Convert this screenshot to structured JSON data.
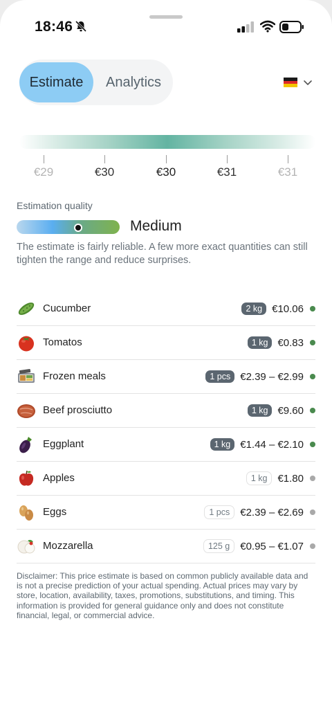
{
  "status_bar": {
    "time": "18:46"
  },
  "tabs": [
    {
      "label": "Estimate",
      "active": true
    },
    {
      "label": "Analytics",
      "active": false
    }
  ],
  "country_flag": "germany-flag-icon",
  "range": {
    "ticks": [
      "€29",
      "€30",
      "€30",
      "€31",
      "€31"
    ],
    "tick_colors": [
      "#b4b4b4",
      "#333333",
      "#222222",
      "#333333",
      "#b4b4b4"
    ]
  },
  "quality": {
    "label": "Estimation quality",
    "value": "Medium",
    "level": 0.6,
    "description": "The estimate is fairly reliable. A few more exact quantities can still tighten the range and reduce surprises."
  },
  "items": [
    {
      "name": "Cucumber",
      "quantity": "2 kg",
      "price": "€10.06",
      "badge_style": "dark",
      "status_color": "#4a8a4e",
      "icon": "cucumber-icon"
    },
    {
      "name": "Tomatos",
      "quantity": "1 kg",
      "price": "€0.83",
      "badge_style": "dark",
      "status_color": "#4a8a4e",
      "icon": "tomato-icon"
    },
    {
      "name": "Frozen meals",
      "quantity": "1 pcs",
      "price": "€2.39 – €2.99",
      "badge_style": "dark",
      "status_color": "#4a8a4e",
      "icon": "frozen-meal-icon"
    },
    {
      "name": "Beef prosciutto",
      "quantity": "1 kg",
      "price": "€9.60",
      "badge_style": "dark",
      "status_color": "#4a8a4e",
      "icon": "prosciutto-icon"
    },
    {
      "name": "Eggplant",
      "quantity": "1 kg",
      "price": "€1.44 – €2.10",
      "badge_style": "dark",
      "status_color": "#4a8a4e",
      "icon": "eggplant-icon"
    },
    {
      "name": "Apples",
      "quantity": "1 kg",
      "price": "€1.80",
      "badge_style": "light",
      "status_color": "#a9a9a9",
      "icon": "apple-icon"
    },
    {
      "name": "Eggs",
      "quantity": "1 pcs",
      "price": "€2.39 – €2.69",
      "badge_style": "light",
      "status_color": "#a9a9a9",
      "icon": "eggs-icon"
    },
    {
      "name": "Mozzarella",
      "quantity": "125 g",
      "price": "€0.95 – €1.07",
      "badge_style": "light",
      "status_color": "#a9a9a9",
      "icon": "mozzarella-icon"
    }
  ],
  "disclaimer": "Disclaimer: This price estimate is based on common publicly available data and is not a precise prediction of your actual spending. Actual prices may vary by store, location, availability, taxes, promotions, substitutions, and timing. This information is provided for general guidance only and does not constitute financial, legal, or commercial advice."
}
